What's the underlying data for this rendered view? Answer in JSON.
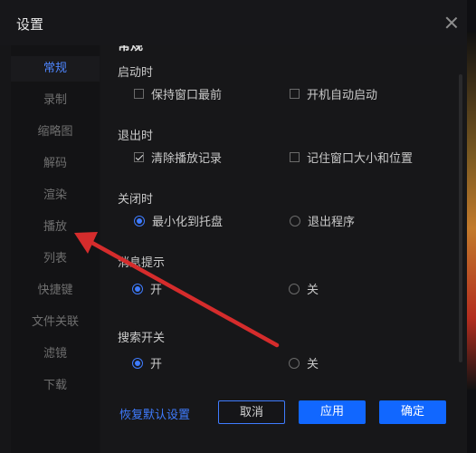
{
  "window": {
    "title": "设置"
  },
  "sidebar": {
    "items": [
      {
        "label": "常规",
        "active": true
      },
      {
        "label": "录制",
        "active": false
      },
      {
        "label": "缩略图",
        "active": false
      },
      {
        "label": "解码",
        "active": false
      },
      {
        "label": "渲染",
        "active": false
      },
      {
        "label": "播放",
        "active": false
      },
      {
        "label": "列表",
        "active": false
      },
      {
        "label": "快捷键",
        "active": false
      },
      {
        "label": "文件关联",
        "active": false
      },
      {
        "label": "滤镜",
        "active": false
      },
      {
        "label": "下载",
        "active": false
      }
    ]
  },
  "content": {
    "header": "常规",
    "sections": {
      "startup": {
        "title": "启动时",
        "opt1": {
          "label": "保持窗口最前",
          "checked": false
        },
        "opt2": {
          "label": "开机自动启动",
          "checked": false
        }
      },
      "exit": {
        "title": "退出时",
        "opt1": {
          "label": "清除播放记录",
          "checked": true
        },
        "opt2": {
          "label": "记住窗口大小和位置",
          "checked": false
        }
      },
      "close": {
        "title": "关闭时",
        "opt1": {
          "label": "最小化到托盘",
          "selected": true
        },
        "opt2": {
          "label": "退出程序",
          "selected": false
        }
      },
      "message": {
        "title": "消息提示",
        "opt1": {
          "label": "开",
          "selected": true
        },
        "opt2": {
          "label": "关",
          "selected": false
        }
      },
      "search": {
        "title": "搜索开关",
        "opt1": {
          "label": "开",
          "selected": true
        },
        "opt2": {
          "label": "关",
          "selected": false
        }
      }
    }
  },
  "footer": {
    "restore_defaults": "恢复默认设置",
    "cancel": "取消",
    "apply": "应用",
    "ok": "确定"
  },
  "colors": {
    "accent": "#1167ff",
    "accent_light": "#3f7cff",
    "arrow": "#d52c2c"
  }
}
